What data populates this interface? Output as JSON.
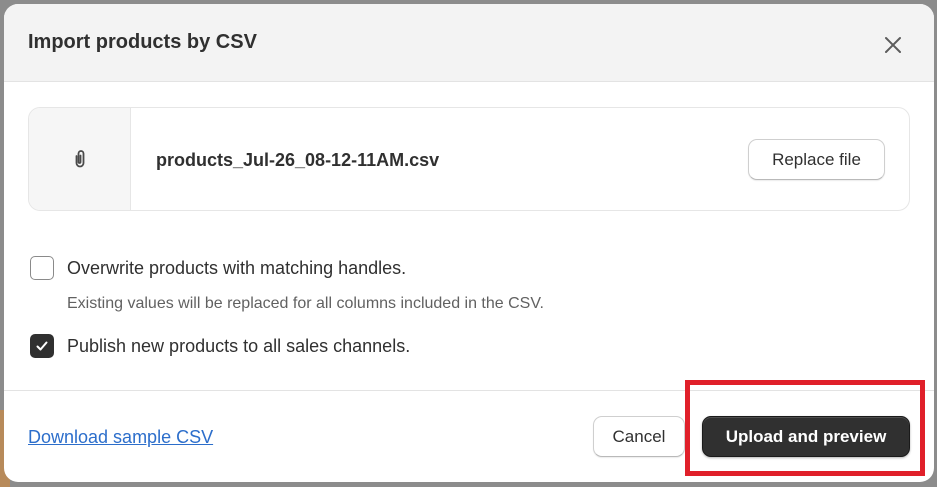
{
  "modal": {
    "title": "Import products by CSV",
    "close_icon": "close-icon"
  },
  "file": {
    "icon": "paperclip-icon",
    "name": "products_Jul-26_08-12-11AM.csv",
    "replace_label": "Replace file"
  },
  "options": {
    "overwrite": {
      "label": "Overwrite products with matching handles.",
      "help": "Existing values will be replaced for all columns included in the CSV.",
      "checked": false
    },
    "publish": {
      "label": "Publish new products to all sales channels.",
      "checked": true
    }
  },
  "footer": {
    "download_label": "Download sample CSV",
    "cancel_label": "Cancel",
    "upload_label": "Upload and preview"
  },
  "colors": {
    "primary_button": "#303030",
    "link": "#2c6ecb",
    "highlight": "#e0202a"
  }
}
